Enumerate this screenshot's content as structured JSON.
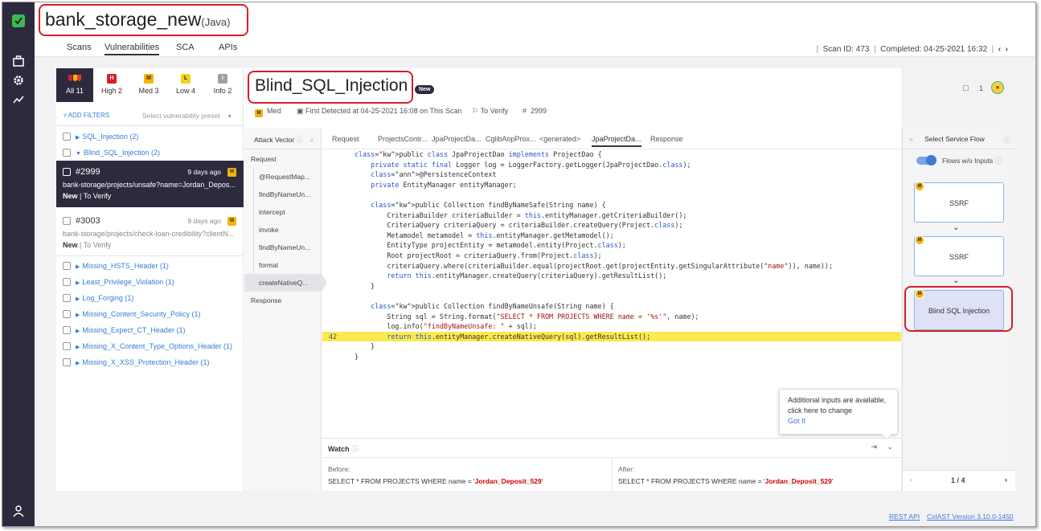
{
  "app": {
    "project_name": "bank_storage_new",
    "language": "(Java)"
  },
  "top_tabs": [
    {
      "label": "Scans"
    },
    {
      "label": "Vulnerabilities"
    },
    {
      "label": "SCA"
    },
    {
      "label": "APIs"
    }
  ],
  "scan_meta": {
    "scan_id": "Scan ID: 473",
    "completed": "Completed: 04-25-2021 16:32"
  },
  "severity_tabs": [
    {
      "label": "All 11",
      "badge": ""
    },
    {
      "label": "High 2",
      "badge": "H"
    },
    {
      "label": "Med 3",
      "badge": "M"
    },
    {
      "label": "Low 4",
      "badge": "L"
    },
    {
      "label": "Info 2",
      "badge": "I"
    }
  ],
  "filters": {
    "add_filters": "ADD FILTERS",
    "preset_placeholder": "Select vulnerability preset"
  },
  "vuln_groups_top": [
    {
      "label": "SQL_Injection (2)"
    },
    {
      "label": "Blind_SQL_Injection (2)"
    }
  ],
  "cards": [
    {
      "id": "#2999",
      "age": "9 days ago",
      "path": "bank-storage/projects/unsafe?name=Jordan_Depos...",
      "status": "New",
      "state": "To Verify"
    },
    {
      "id": "#3003",
      "age": "9 days ago",
      "path": "bank-storage/projects/check-loan-credibility?clientN...",
      "status": "New",
      "state": "To Verify"
    }
  ],
  "vuln_groups_bottom": [
    {
      "label": "Missing_HSTS_Header (1)"
    },
    {
      "label": "Least_Privilege_Violation (1)"
    },
    {
      "label": "Log_Forging (1)"
    },
    {
      "label": "Missing_Content_Security_Policy (1)"
    },
    {
      "label": "Missing_Expect_CT_Header (1)"
    },
    {
      "label": "Missing_X_Content_Type_Options_Header (1)"
    },
    {
      "label": "Missing_X_XSS_Protection_Header (1)"
    }
  ],
  "vuln": {
    "title": "Blind_SQL_Injection",
    "badge": "New",
    "severity": "Med",
    "first_detected": "First Detected at 04-25-2021 16:08 on This Scan",
    "state": "To Verify",
    "id": "2999",
    "comment_count": "1"
  },
  "attack_vector": {
    "header": "Attack Vector",
    "items": [
      "Request",
      "@RequestMap...",
      "findByNameUn...",
      "intercept",
      "invoke",
      "findByNameUn...",
      "format",
      "createNativeQ...",
      "Response"
    ]
  },
  "file_tabs": [
    "Request",
    "ProjectsContr...",
    "JpaProjectDa...",
    "CglibAopProx...",
    "<generated>",
    "JpaProjectDa...",
    "Response"
  ],
  "code": {
    "highlight_line_number": "42",
    "lines": [
      "public class JpaProjectDao implements ProjectDao {",
      "    private static final Logger log = LoggerFactory.getLogger(JpaProjectDao.class);",
      "    @PersistenceContext",
      "    private EntityManager entityManager;",
      "",
      "    public Collection findByNameSafe(String name) {",
      "        CriteriaBuilder criteriaBuilder = this.entityManager.getCriteriaBuilder();",
      "        CriteriaQuery criteriaQuery = criteriaBuilder.createQuery(Project.class);",
      "        Metamodel metamodel = this.entityManager.getMetamodel();",
      "        EntityType projectEntity = metamodel.entity(Project.class);",
      "        Root projectRoot = criteriaQuery.from(Project.class);",
      "        criteriaQuery.where(criteriaBuilder.equal(projectRoot.get(projectEntity.getSingularAttribute(\"name\")), name));",
      "        return this.entityManager.createQuery(criteriaQuery).getResultList();",
      "    }",
      "",
      "    public Collection findByNameUnsafe(String name) {",
      "        String sql = String.format(\"SELECT * FROM PROJECTS WHERE name = '%s'\", name);",
      "        log.info(\"findByNameUnsafe: \" + sql);",
      "        return this.entityManager.createNativeQuery(sql).getResultList();",
      "    }",
      "}"
    ]
  },
  "tooltip": {
    "line1": "Additional inputs are available,",
    "line2": "click here to change",
    "action": "Got It"
  },
  "watch": {
    "title": "Watch",
    "before_label": "Before:",
    "before_prefix": "SELECT * FROM PROJECTS WHERE name = '",
    "before_value": "Jordan_Deposit_529",
    "after_label": "After:",
    "after_prefix": "SELECT * FROM PROJECTS WHERE name = '",
    "after_value": "Jordan_Deposit_529",
    "quote": "'"
  },
  "service_flow": {
    "header": "Select Service Flow",
    "toggle_label": "Flows w/o Inputs",
    "flows": [
      "SSRF",
      "SSRF",
      "Blind SQL Injection"
    ],
    "pager": "1 / 4"
  },
  "footer": {
    "rest_api": "REST API",
    "version": "CxIAST Version 3.10.0-1450"
  },
  "colors": {
    "sidebar": "#2d2a3e",
    "accent": "#3a7bd5",
    "highlight": "#fce94f",
    "annotation_red": "#d61f26",
    "brand_green": "#3dba4e"
  }
}
